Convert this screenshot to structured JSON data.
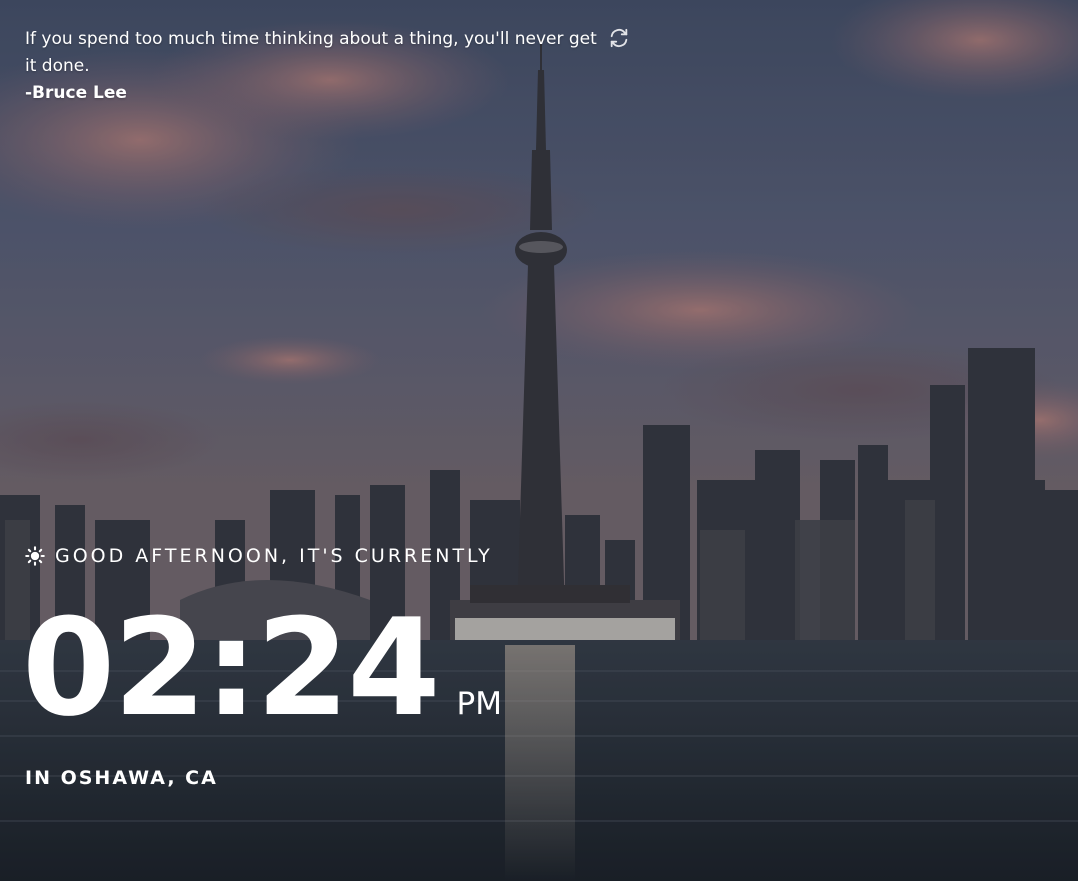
{
  "quote": {
    "text": "If you spend too much time thinking about a thing, you'll never get it done.",
    "author": "-Bruce Lee",
    "refresh_icon": "refresh-icon"
  },
  "greeting": {
    "icon": "sun-icon",
    "text": "GOOD AFTERNOON, IT'S CURRENTLY"
  },
  "clock": {
    "time": "02:24",
    "meridiem": "PM"
  },
  "location": {
    "text": "IN OSHAWA, CA"
  },
  "colors": {
    "text": "#ffffff",
    "sky_top": "#4d5d78",
    "sky_mid": "#6b6f86",
    "water": "#2c3540"
  }
}
